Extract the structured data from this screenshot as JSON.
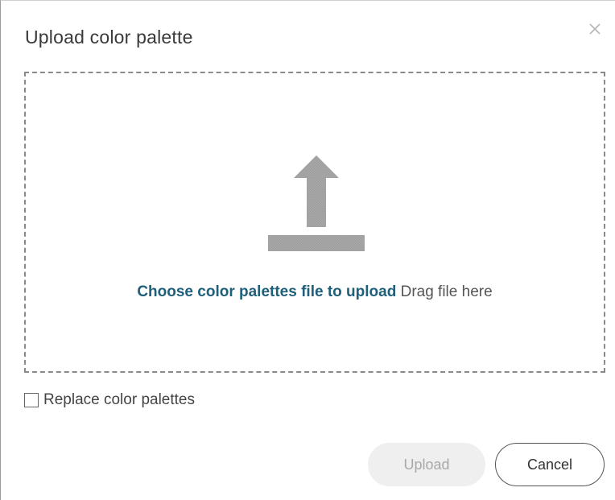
{
  "dialog": {
    "title": "Upload color palette"
  },
  "dropzone": {
    "choose_link": "Choose color palettes file to upload",
    "drag_text": "Drag file here",
    "icon": "upload-icon"
  },
  "options": {
    "replace_label": "Replace color palettes",
    "replace_checked": false
  },
  "buttons": {
    "upload_label": "Upload",
    "cancel_label": "Cancel",
    "upload_disabled": true
  },
  "colors": {
    "link": "#1f5f7a",
    "icon": "#a6a6a6",
    "disabled_bg": "#efefef"
  }
}
